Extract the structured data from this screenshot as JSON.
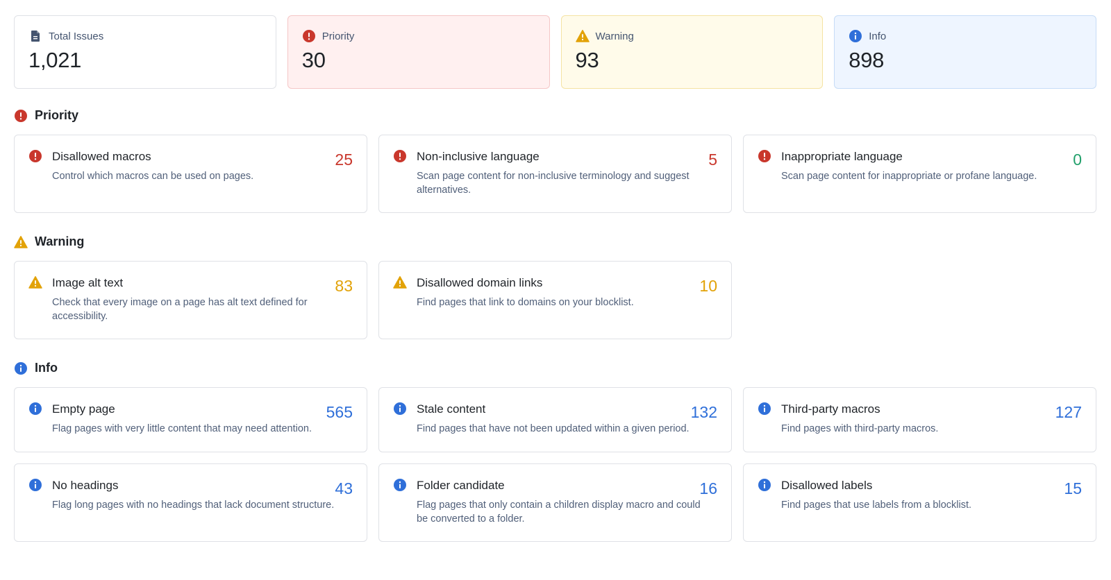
{
  "summary": {
    "total": {
      "label": "Total Issues",
      "value": "1,021"
    },
    "priority": {
      "label": "Priority",
      "value": "30"
    },
    "warning": {
      "label": "Warning",
      "value": "93"
    },
    "info": {
      "label": "Info",
      "value": "898"
    }
  },
  "sections": {
    "priority": {
      "title": "Priority",
      "cards": [
        {
          "title": "Disallowed macros",
          "description": "Control which macros can be used on pages.",
          "count": "25"
        },
        {
          "title": "Non-inclusive language",
          "description": "Scan page content for non-inclusive terminology and suggest alternatives.",
          "count": "5"
        },
        {
          "title": "Inappropriate language",
          "description": "Scan page content for inappropriate or profane language.",
          "count": "0"
        }
      ]
    },
    "warning": {
      "title": "Warning",
      "cards": [
        {
          "title": "Image alt text",
          "description": "Check that every image on a page has alt text defined for accessibility.",
          "count": "83"
        },
        {
          "title": "Disallowed domain links",
          "description": "Find pages that link to domains on your blocklist.",
          "count": "10"
        }
      ]
    },
    "info": {
      "title": "Info",
      "cards": [
        {
          "title": "Empty page",
          "description": "Flag pages with very little content that may need attention.",
          "count": "565"
        },
        {
          "title": "Stale content",
          "description": "Find pages that have not been updated within a given period.",
          "count": "132"
        },
        {
          "title": "Third-party macros",
          "description": "Find pages with third-party macros.",
          "count": "127"
        },
        {
          "title": "No headings",
          "description": "Flag long pages with no headings that lack document structure.",
          "count": "43"
        },
        {
          "title": "Folder candidate",
          "description": "Flag pages that only contain a children display macro and could be converted to a folder.",
          "count": "16"
        },
        {
          "title": "Disallowed labels",
          "description": "Find pages that use labels from a blocklist.",
          "count": "15"
        }
      ]
    }
  },
  "colors": {
    "priority": "#c9372c",
    "warning": "#e2a208",
    "info": "#2f6fd9",
    "zero": "#22a06b"
  },
  "icons": {
    "total": "document-icon",
    "priority": "error-icon",
    "warning": "warning-icon",
    "info": "info-icon"
  }
}
